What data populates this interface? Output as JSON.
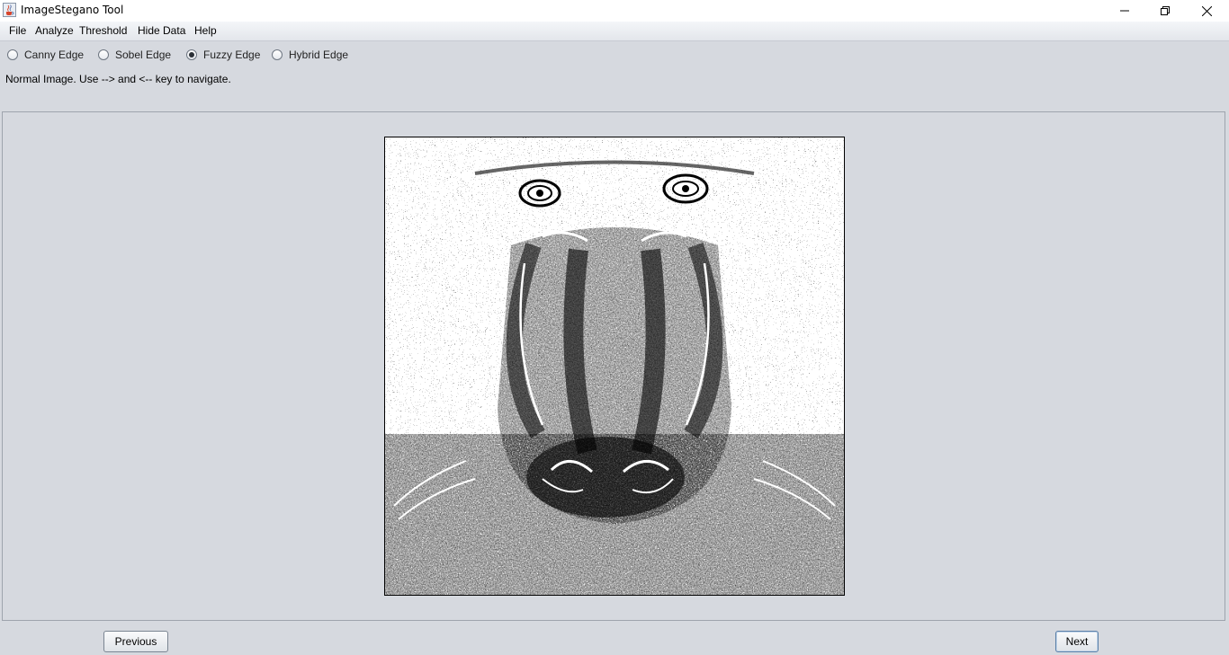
{
  "window": {
    "title": "ImageStegano Tool",
    "icon": "java-cup-icon",
    "controls": [
      "minimize-icon",
      "restore-icon",
      "close-icon"
    ]
  },
  "menu": {
    "items": [
      "File",
      "Analyze",
      "Threshold",
      "Hide Data",
      "Help"
    ]
  },
  "edge_options": {
    "items": [
      {
        "label": "Canny Edge",
        "checked": false
      },
      {
        "label": "Sobel Edge",
        "checked": false
      },
      {
        "label": "Fuzzy Edge",
        "checked": true
      },
      {
        "label": "Hybrid Edge",
        "checked": false
      }
    ]
  },
  "status": "Normal Image. Use --> and <-- key to navigate.",
  "viewer": {
    "image": "fuzzy-edge-mandrill-image"
  },
  "buttons": {
    "previous": "Previous",
    "next": "Next"
  },
  "colors": {
    "background": "#d6d9df",
    "titlebar": "#ffffff",
    "image_border": "#000000"
  }
}
